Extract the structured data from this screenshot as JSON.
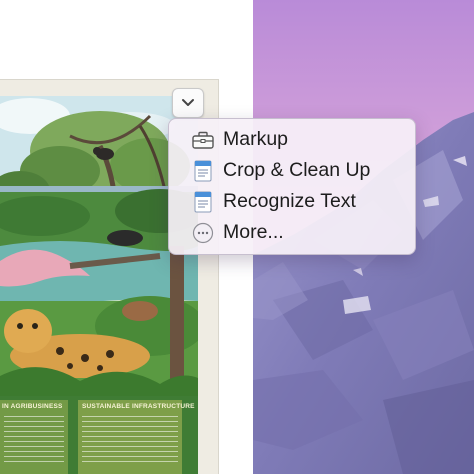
{
  "menu": {
    "items": [
      {
        "label": "Markup",
        "icon": "toolbox-icon"
      },
      {
        "label": "Crop & Clean Up",
        "icon": "document-app-icon"
      },
      {
        "label": "Recognize Text",
        "icon": "document-app-icon"
      },
      {
        "label": "More...",
        "icon": "ellipsis-circle-icon"
      }
    ]
  },
  "document": {
    "panel_left_heading": "IN AGRIBUSINESS",
    "panel_right_heading": "SUSTAINABLE INFRASTRUCTURE"
  },
  "toolbar": {
    "collapse_icon": "chevron-down-icon"
  },
  "colors": {
    "menu_bg": "#f6f0f8",
    "wallpaper_top": "#c98fd6",
    "wallpaper_mountain": "#7d79b4",
    "doc_frame": "#efece3"
  }
}
